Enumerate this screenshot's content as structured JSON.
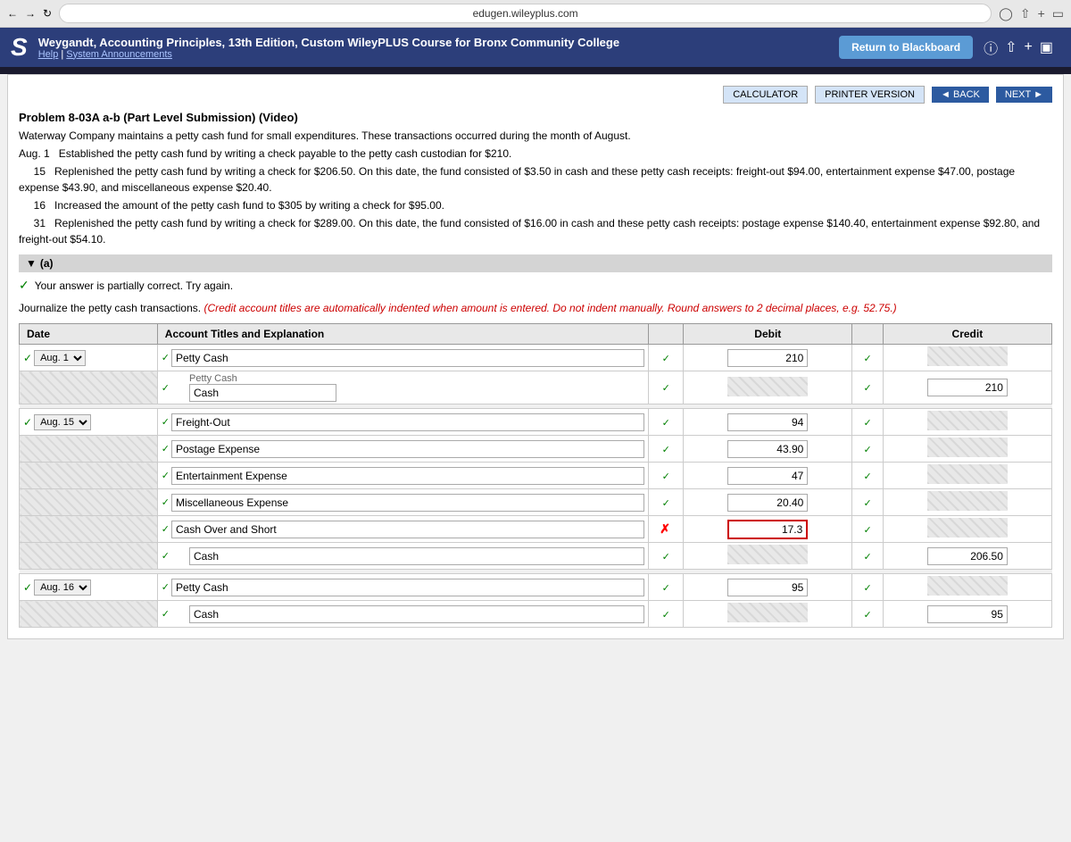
{
  "browser": {
    "url": "edugen.wileyplus.com"
  },
  "header": {
    "logo": "S",
    "title": "Weygandt, Accounting Principles, 13th Edition, Custom WileyPLUS Course for Bronx Community College",
    "help_link": "Help",
    "announcements_link": "System Announcements",
    "return_button": "Return to Blackboard"
  },
  "actions": {
    "calculator": "CALCULATOR",
    "printer_version": "PRINTER VERSION",
    "back": "◄ BACK",
    "next": "NEXT ►"
  },
  "problem": {
    "title": "Problem 8-03A a-b (Part Level Submission) (Video)",
    "company": "Waterway Company",
    "description_lines": [
      "Waterway Company maintains a petty cash fund for small expenditures. These transactions occurred during the month of August.",
      "Aug. 1  Established the petty cash fund by writing a check payable to the petty cash custodian for $210.",
      "     15  Replenished the petty cash fund by writing a check for $206.50. On this date, the fund consisted of $3.50 in cash and these petty cash receipts: freight-out $94.00, entertainment expense $47.00, postage expense $43.90, and miscellaneous expense $20.40.",
      "     16  Increased the amount of the petty cash fund to $305 by writing a check for $95.00.",
      "     31  Replenished the petty cash fund by writing a check for $289.00. On this date, the fund consisted of $16.00 in cash and these petty cash receipts: postage expense $140.40, entertainment expense $92.80, and freight-out $54.10."
    ]
  },
  "section_a": {
    "label": "(a)",
    "partial_correct_msg": "Your answer is partially correct.  Try again.",
    "instruction": "Journalize the petty cash transactions.",
    "instruction_italic": "(Credit account titles are automatically indented when amount is entered. Do not indent manually. Round answers to 2 decimal places, e.g. 52.75.)"
  },
  "table": {
    "headers": [
      "Date",
      "Account Titles and Explanation",
      "",
      "Debit",
      "",
      "Credit"
    ],
    "rows": [
      {
        "date": "Aug. 1",
        "account": "Petty Cash",
        "indent": false,
        "debit": "210",
        "credit": "",
        "has_debit": true,
        "has_credit": false
      },
      {
        "date": "",
        "account": "Cash",
        "indent": true,
        "debit": "",
        "credit": "210",
        "has_debit": false,
        "has_credit": true,
        "indented_label": "Petty Cash"
      },
      {
        "date": "Aug. 15",
        "account": "Freight-Out",
        "indent": false,
        "debit": "94",
        "credit": "",
        "has_debit": true,
        "has_credit": false
      },
      {
        "date": "",
        "account": "Postage Expense",
        "indent": false,
        "debit": "43.90",
        "credit": "",
        "has_debit": true,
        "has_credit": false
      },
      {
        "date": "",
        "account": "Entertainment Expense",
        "indent": false,
        "debit": "47",
        "credit": "",
        "has_debit": true,
        "has_credit": false
      },
      {
        "date": "",
        "account": "Miscellaneous Expense",
        "indent": false,
        "debit": "20.40",
        "credit": "",
        "has_debit": true,
        "has_credit": false
      },
      {
        "date": "",
        "account": "Cash Over and Short",
        "indent": false,
        "debit": "17.3",
        "credit": "",
        "has_debit": true,
        "has_credit": false,
        "error": true
      },
      {
        "date": "",
        "account": "Cash",
        "indent": true,
        "debit": "",
        "credit": "206.50",
        "has_debit": false,
        "has_credit": true
      },
      {
        "date": "Aug. 16",
        "account": "Petty Cash",
        "indent": false,
        "debit": "95",
        "credit": "",
        "has_debit": true,
        "has_credit": false
      },
      {
        "date": "",
        "account": "Cash",
        "indent": true,
        "debit": "",
        "credit": "95",
        "has_debit": false,
        "has_credit": true
      }
    ]
  }
}
